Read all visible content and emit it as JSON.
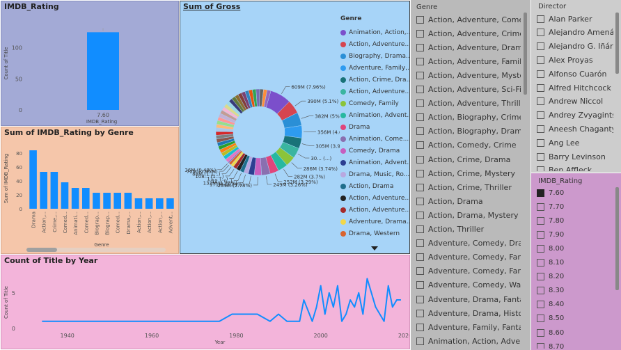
{
  "imdb_panel": {
    "title": "IMDB_Rating"
  },
  "genre_bar_panel": {
    "title": "Sum of IMDB_Rating by Genre"
  },
  "gross_panel": {
    "title": "Sum of Gross"
  },
  "year_panel": {
    "title": "Count of Title by Year"
  },
  "genre_slicer": {
    "header": "Genre",
    "items": [
      "Action, Adventure, Comedy",
      "Action, Adventure, Crime",
      "Action, Adventure, Drama",
      "Action, Adventure, Family",
      "Action, Adventure, Mystery",
      "Action, Adventure, Sci-Fi",
      "Action, Adventure, Thriller",
      "Action, Biography, Crime",
      "Action, Biography, Drama",
      "Action, Comedy, Crime",
      "Action, Crime, Drama",
      "Action, Crime, Mystery",
      "Action, Crime, Thriller",
      "Action, Drama",
      "Action, Drama, Mystery",
      "Action, Thriller",
      "Adventure, Comedy, Drama",
      "Adventure, Comedy, Family",
      "Adventure, Comedy, Fantasy",
      "Adventure, Comedy, War",
      "Adventure, Drama, Fantasy",
      "Adventure, Drama, History",
      "Adventure, Family, Fantasy",
      "Animation, Action, Adventu..."
    ]
  },
  "director_slicer": {
    "header": "Director",
    "items": [
      "Alan Parker",
      "Alejandro Amenábar",
      "Alejandro G. Iñárritu",
      "Alex Proyas",
      "Alfonso Cuarón",
      "Alfred Hitchcock",
      "Andrew Niccol",
      "Andrey Zvyagintsev",
      "Aneesh Chaganty",
      "Ang Lee",
      "Barry Levinson",
      "Ben Affleck"
    ]
  },
  "rating_slicer": {
    "header": "IMDB_Rating",
    "items": [
      "7.60",
      "7.70",
      "7.80",
      "7.90",
      "8.00",
      "8.10",
      "8.20",
      "8.30",
      "8.40",
      "8.50",
      "8.60",
      "8.70"
    ],
    "checked": [
      "7.60"
    ]
  },
  "colors": {
    "bar_blue": "#118DFF",
    "panel_lavender": "#A3AAD6",
    "panel_peach": "#F5C6AA",
    "panel_sky": "#A7D4F8",
    "panel_pink": "#F3B4DA",
    "slicer_gray": "#BABABA",
    "director_bg": "#CDCDCD",
    "rating_bg": "#CC99CC"
  },
  "chart_data": [
    {
      "id": "imdb_rating_bar",
      "type": "bar",
      "title": "IMDB_Rating",
      "categories": [
        "7.60"
      ],
      "values": [
        125
      ],
      "xlabel": "IMDB_Rating",
      "ylabel": "Count of Title",
      "yticks": [
        "0",
        "50",
        "100"
      ],
      "ylim": [
        0,
        150
      ]
    },
    {
      "id": "genre_rating_bar",
      "type": "bar",
      "title": "Sum of IMDB_Rating by Genre",
      "categories": [
        "Drama",
        "Action,...",
        "Crime,...",
        "Comed...",
        "Animati...",
        "Comed...",
        "Biograp...",
        "Biograp...",
        "Comed...",
        "Drama,...",
        "Action,...",
        "Action,...",
        "Action,...",
        "Advent..."
      ],
      "values": [
        84,
        53,
        53,
        38,
        30,
        30,
        23,
        23,
        23,
        23,
        15,
        15,
        15,
        15
      ],
      "xlabel": "Genre",
      "ylabel": "Sum of IMDB_Rating",
      "yticks": [
        "0",
        "20",
        "40",
        "60",
        "80"
      ],
      "ylim": [
        0,
        95
      ]
    },
    {
      "id": "gross_donut",
      "type": "pie",
      "title": "Sum of Gross",
      "legend_title": "Genre",
      "legend": [
        {
          "name": "Animation, Action,...",
          "color": "#7B4FCB"
        },
        {
          "name": "Action, Adventure...",
          "color": "#D64550"
        },
        {
          "name": "Biography, Drama...",
          "color": "#2A8FD6"
        },
        {
          "name": "Adventure, Family,...",
          "color": "#2E9BF0"
        },
        {
          "name": "Action, Crime, Dra...",
          "color": "#197278"
        },
        {
          "name": "Action, Adventure...",
          "color": "#3AB5A0"
        },
        {
          "name": "Comedy, Family",
          "color": "#8BC43A"
        },
        {
          "name": "Animation, Advent...",
          "color": "#27B8A0"
        },
        {
          "name": "Drama",
          "color": "#E0457B"
        },
        {
          "name": "Animation, Come...",
          "color": "#8A6FB0"
        },
        {
          "name": "Comedy, Drama",
          "color": "#C65FBF"
        },
        {
          "name": "Animation, Advent...",
          "color": "#2C3E91"
        },
        {
          "name": "Drama, Music, Ro...",
          "color": "#B8A8E0"
        },
        {
          "name": "Action, Drama",
          "color": "#1F6E8C"
        },
        {
          "name": "Action, Adventure...",
          "color": "#222222"
        },
        {
          "name": "Action, Adventure...",
          "color": "#A52A2A"
        },
        {
          "name": "Adventure, Drama...",
          "color": "#F2D74A"
        },
        {
          "name": "Drama, Western",
          "color": "#D9642F"
        }
      ],
      "labels": [
        "609M (7.96%)",
        "390M (5.1%)",
        "382M (5%)",
        "356M (4.66%)",
        "305M (3.99%)",
        "30... (...)",
        "286M (3.74%)",
        "282M (3.7%)",
        "252M (3.29%)",
        "249M (3.26%)",
        "209M (2.73%)",
        "171M (2.24%)",
        "132M (1.73%)",
        "11... (...)",
        "11... (...)",
        "108... (1....)",
        "88M (1.1...)",
        "72M (0.95%)",
        "36M (0.48%)"
      ],
      "values": [
        7.96,
        5.1,
        5.0,
        4.66,
        3.99,
        3.9,
        3.74,
        3.7,
        3.29,
        3.26,
        2.73,
        2.24,
        1.73,
        1.5,
        1.5,
        1.4,
        1.15,
        0.95,
        0.48
      ]
    },
    {
      "id": "title_by_year_line",
      "type": "line",
      "title": "Count of Title by Year",
      "xlabel": "Year",
      "ylabel": "Count of Title",
      "xticks": [
        "1940",
        "1960",
        "1980",
        "2000",
        "2020"
      ],
      "yticks": [
        "0",
        "5"
      ],
      "xlim": [
        1929,
        2020
      ],
      "ylim": [
        0,
        8.5
      ],
      "x": [
        1934,
        1940,
        1950,
        1960,
        1970,
        1976,
        1979,
        1985,
        1988,
        1990,
        1992,
        1995,
        1996,
        1998,
        1999,
        2000,
        2001,
        2002,
        2003,
        2004,
        2005,
        2006,
        2007,
        2008,
        2009,
        2010,
        2011,
        2012,
        2013,
        2014,
        2015,
        2016,
        2017,
        2018,
        2019
      ],
      "y": [
        1,
        1,
        1,
        1,
        1,
        1,
        2,
        2,
        1,
        2,
        1,
        1,
        4,
        1,
        3,
        6,
        2,
        5,
        3,
        6,
        1,
        2,
        4,
        3,
        5,
        2,
        7,
        5,
        3,
        2,
        1,
        6,
        3,
        4,
        4
      ]
    }
  ]
}
